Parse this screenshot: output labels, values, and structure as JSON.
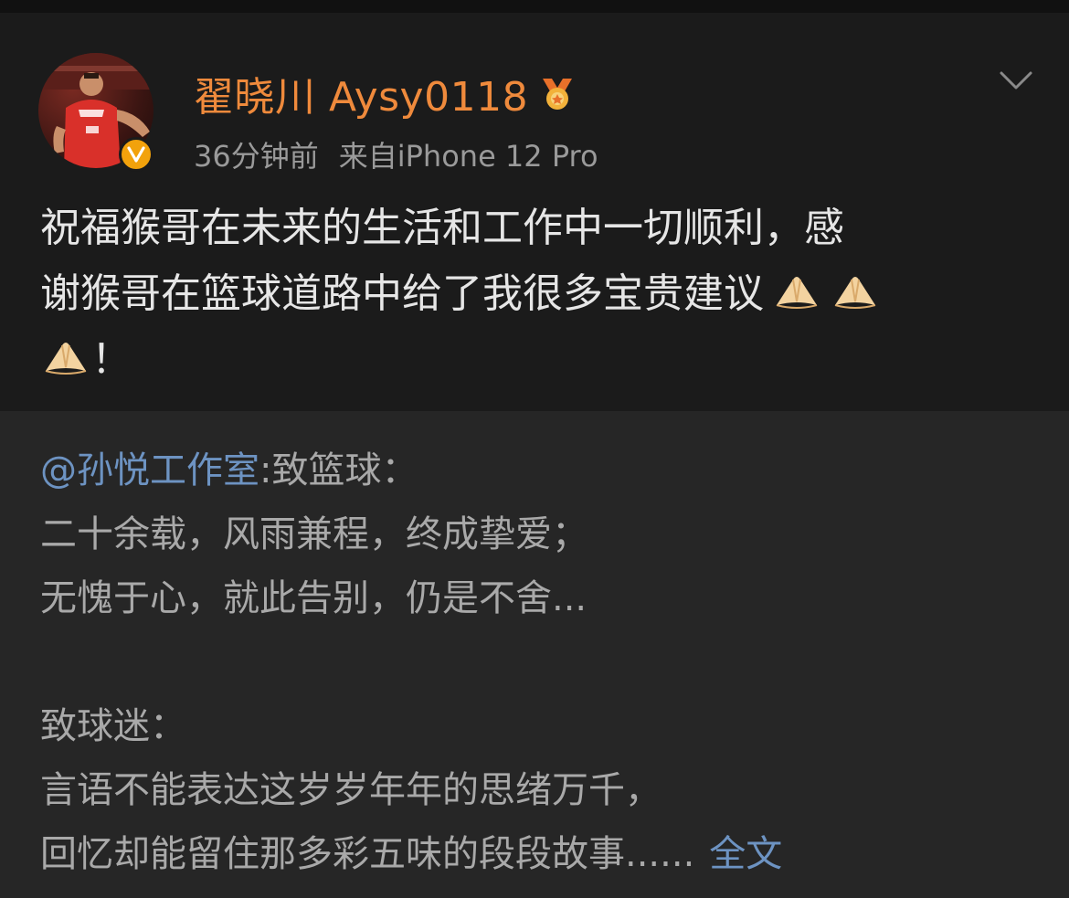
{
  "post": {
    "author": "翟晓川 Aysy0118",
    "time_ago": "36分钟前",
    "source": "来自iPhone 12 Pro",
    "text_lines": [
      "祝福猴哥在未来的生活和工作中一切顺利，感",
      "谢猴哥在篮球道路中给了我很多宝贵建议",
      "！"
    ],
    "icons": {
      "medal": "medal-icon",
      "verified": "verified-badge-icon",
      "more": "chevron-down-icon",
      "emoji": "folded-hands-icon"
    },
    "colors": {
      "username": "#ef8a3c",
      "verified": "#f2a20c",
      "link": "#6d93c2"
    }
  },
  "repost": {
    "mention": "@孙悦工作室",
    "after_mention": ":致篮球：",
    "lines": [
      "二十余载，风雨兼程，终成挚爱；",
      "无愧于心，就此告别，仍是不舍...",
      "",
      "致球迷：",
      "言语不能表达这岁岁年年的思绪万千，",
      "回忆却能留住那多彩五味的段段故事......"
    ],
    "full_text_link": "全文"
  }
}
